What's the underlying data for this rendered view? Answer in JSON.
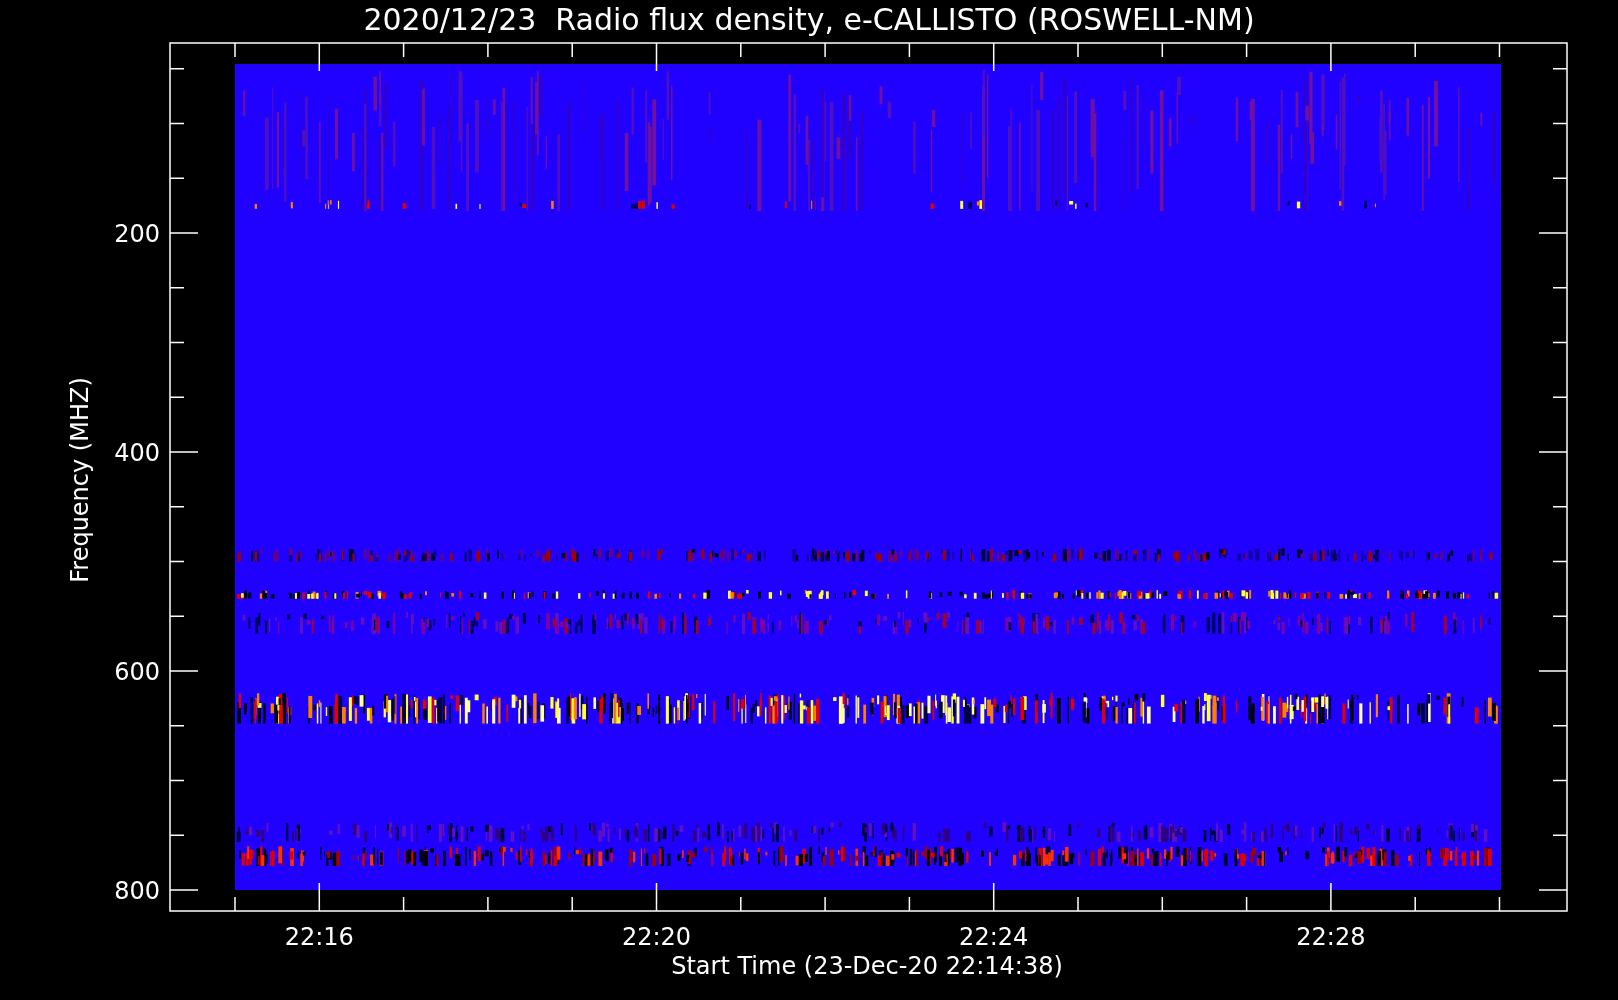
{
  "plot": {
    "title": "2020/12/23  Radio flux density, e-CALLISTO (ROSWELL-NM)",
    "xlabel": "Start Time (23-Dec-20 22:14:38)",
    "ylabel": "Frequency (MHZ)",
    "x_tick_labels": [
      "22:16",
      "22:20",
      "22:24",
      "22:28"
    ],
    "y_tick_labels": [
      "200",
      "400",
      "600",
      "800"
    ]
  }
}
